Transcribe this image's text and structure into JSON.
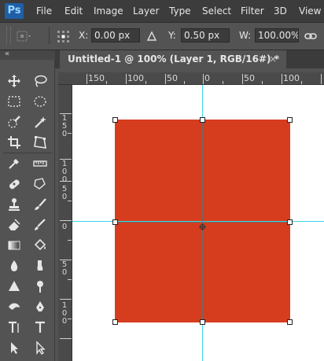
{
  "app": {
    "logo": "Ps"
  },
  "menu": {
    "items": [
      "File",
      "Edit",
      "Image",
      "Layer",
      "Type",
      "Select",
      "Filter",
      "3D",
      "View"
    ]
  },
  "options": {
    "x_label": "X:",
    "x_value": "0.00 px",
    "angle_icon": "angle-icon",
    "y_label": "Y:",
    "y_value": "0.50 px",
    "w_label": "W:",
    "w_value": "100.00%",
    "link_icon": "link-icon"
  },
  "tab": {
    "title": "Untitled-1 @ 100% (Layer 1, RGB/16#) *",
    "close": "×"
  },
  "tool_header": {
    "collapse": "«"
  },
  "ruler": {
    "top_labels": [
      "150",
      "100",
      "50",
      "0",
      "50",
      "100"
    ],
    "left_labels": [
      "1\n5\n0",
      "1\n0\n0",
      "5\n0",
      "0",
      "5\n0",
      "1\n0\n0"
    ]
  },
  "colors": {
    "layer": "#d63d1f",
    "guide": "#3fd6e6",
    "ui_dark": "#3c3c3c",
    "ui_mid": "#535353"
  },
  "tools": [
    "move-tool-icon",
    "lasso-tool-icon",
    "rect-marquee-icon",
    "ellipse-marquee-icon",
    "quick-selection-icon",
    "magic-wand-icon",
    "crop-tool-icon",
    "perspective-crop-icon",
    "eyedropper-icon",
    "ruler-tool-icon",
    "healing-brush-icon",
    "patch-tool-icon",
    "clone-stamp-icon",
    "brush-tool-icon",
    "eraser-icon",
    "history-brush-icon",
    "gradient-tool-icon",
    "paint-bucket-icon",
    "blur-tool-icon",
    "smudge-tool-icon",
    "sharpen-tool-icon",
    "dodge-tool-icon",
    "burn-tool-icon",
    "pen-tool-icon",
    "horizontal-type-icon",
    "vertical-type-icon",
    "path-selection-icon",
    "direct-selection-icon"
  ]
}
